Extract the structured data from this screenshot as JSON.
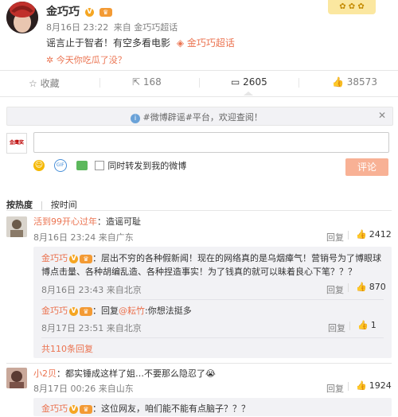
{
  "post": {
    "author": "金巧巧",
    "time": "8月16日 23:22",
    "source_prefix": "来自",
    "source": "金巧巧超话",
    "text": "谣言止于智者！有空多看电影",
    "topic_link": "金巧巧超话",
    "recommend": "今天你吃瓜了没？"
  },
  "actions": {
    "favorite": "收藏",
    "repost": "168",
    "comment": "2605",
    "like": "38573"
  },
  "notice": {
    "text": "#微博辟谣#平台，欢迎查阅！"
  },
  "composer": {
    "avatar_label": "金鹰奖",
    "input_value": "",
    "repost_check_label": "同时转发到我的微博",
    "submit_label": "评论"
  },
  "sort": {
    "by_hot": "按热度",
    "by_time": "按时间"
  },
  "comments": [
    {
      "user": "活到99开心过年",
      "text": "：造谣可耻",
      "time": "8月16日 23:24 来自广东",
      "reply_label": "回复",
      "likes": "2412",
      "replies": [
        {
          "user": "金巧巧",
          "text": "：层出不穷的各种假新闻！现在的网络真的是乌烟瘴气！营销号为了博眼球博点击量、各种胡编乱造、各种捏造事实！为了钱真的就可以昧着良心下笔？？？",
          "time": "8月16日 23:43 来自北京",
          "reply_label": "回复",
          "likes": "870"
        },
        {
          "user": "金巧巧",
          "text_prefix": "：回复",
          "mention": "@耘竹",
          "text": ":你想法挺多",
          "time": "8月17日 23:51 来自北京",
          "reply_label": "回复",
          "likes": "1"
        }
      ],
      "more_replies": "共110条回复"
    },
    {
      "user": "小2贝",
      "text": "：都实锤成这样了姐…不要那么隐忍了😭",
      "time": "8月17日 00:26 来自山东",
      "reply_label": "回复",
      "likes": "1924",
      "replies": [
        {
          "user": "金巧巧",
          "text": "：这位网友，咱们能不能有点脑子？？？"
        }
      ]
    }
  ],
  "colors": {
    "accent": "#eb7350",
    "link": "#eb7350",
    "submit_bg": "#f8b195",
    "sub_bg": "#f2f2f5",
    "notice_bg": "#f2f2f5"
  }
}
